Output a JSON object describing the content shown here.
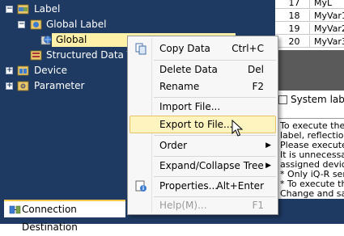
{
  "tree": {
    "label_node": "Label",
    "global_label_node": "Global Label",
    "global_node": "Global",
    "structured_node": "Structured Data Types",
    "device_node": "Device",
    "parameter_node": "Parameter"
  },
  "bottom_tab": {
    "label": "Connection Destination"
  },
  "grid": {
    "rows": [
      {
        "num": "17",
        "name": "MyL"
      },
      {
        "num": "18",
        "name": "MyVar1"
      },
      {
        "num": "19",
        "name": "MyVar2"
      },
      {
        "num": "20",
        "name": "MyVar3"
      }
    ]
  },
  "system_label_checkbox": {
    "text": "System label"
  },
  "info_text": [
    "To execute the",
    "label, reflection",
    "Please execute",
    "It is unnecessa",
    "assigned device",
    "* Only iQ-R ser",
    "* To execute th",
    "Change and sa"
  ],
  "context_menu": {
    "copy_data": {
      "label": "Copy Data",
      "shortcut": "Ctrl+C",
      "icon": "copy-icon"
    },
    "delete_data": {
      "label": "Delete Data",
      "shortcut": "Del"
    },
    "rename": {
      "label": "Rename",
      "shortcut": "F2"
    },
    "import_file": {
      "label": "Import File..."
    },
    "export_file": {
      "label": "Export to File..."
    },
    "order": {
      "label": "Order",
      "arrow": "▶"
    },
    "expand_collapse": {
      "label": "Expand/Collapse Tree",
      "arrow": "▶"
    },
    "properties": {
      "label": "Properties...",
      "shortcut": "Alt+Enter",
      "icon": "properties-icon"
    },
    "help": {
      "label": "Help(M)...",
      "shortcut": "F1"
    }
  },
  "colors": {
    "tree_background": "#1e3a63",
    "selected_background": "#fff2a8",
    "menu_highlight": "#fdf4bf",
    "menu_highlight_border": "#e5c365"
  }
}
